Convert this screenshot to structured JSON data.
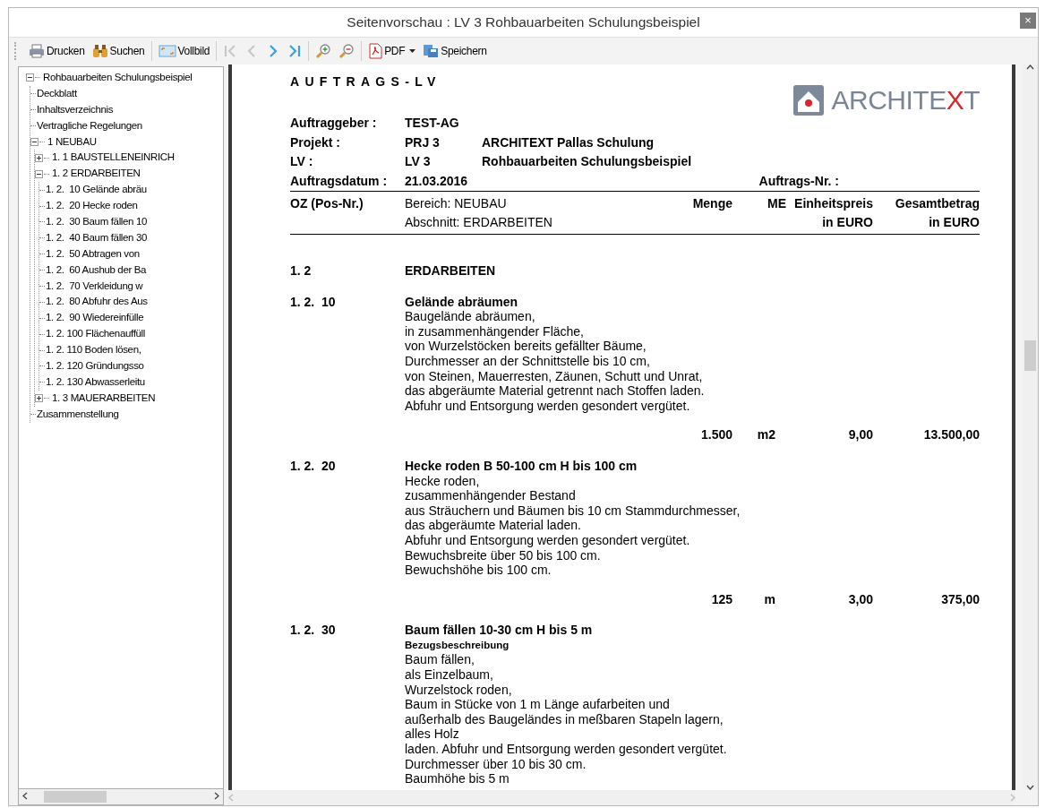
{
  "window": {
    "title": "Seitenvorschau : LV 3 Rohbauarbeiten Schulungsbeispiel",
    "close": "×"
  },
  "toolbar": {
    "groups": [
      {
        "buttons": [
          {
            "kind": "print",
            "label": "Drucken"
          },
          {
            "kind": "search",
            "label": "Suchen"
          }
        ]
      },
      {
        "buttons": [
          {
            "kind": "fullscreen",
            "label": "Vollbild"
          }
        ]
      },
      {
        "buttons": [
          {
            "kind": "first",
            "disabled": true
          },
          {
            "kind": "previous",
            "disabled": true
          },
          {
            "kind": "next",
            "disabled": false
          },
          {
            "kind": "last",
            "disabled": false
          }
        ]
      },
      {
        "buttons": [
          {
            "kind": "zoom-in"
          },
          {
            "kind": "zoom-out"
          }
        ]
      },
      {
        "buttons": [
          {
            "kind": "pdf",
            "label": "PDF",
            "has_menu": true
          },
          {
            "kind": "save",
            "label": "Speichern"
          }
        ]
      }
    ]
  },
  "tree": {
    "items": [
      {
        "label": "Rohbauarbeiten Schulungsbeispiel",
        "expanded": true,
        "children": [
          {
            "label": "Deckblatt"
          },
          {
            "label": "Inhaltsverzeichnis"
          },
          {
            "label": "Vertragliche Regelungen"
          },
          {
            "label": "1 NEUBAU",
            "expanded": true,
            "children": [
              {
                "label": "1. 1 BAUSTELLENEINRICH",
                "expanded": false
              },
              {
                "label": "1. 2 ERDARBEITEN",
                "expanded": true,
                "children": [
                  {
                    "label": "1. 2.  10 Gelände abräu"
                  },
                  {
                    "label": "1. 2.  20 Hecke roden"
                  },
                  {
                    "label": "1. 2.  30 Baum fällen 10"
                  },
                  {
                    "label": "1. 2.  40 Baum fällen 30"
                  },
                  {
                    "label": "1. 2.  50 Abtragen von"
                  },
                  {
                    "label": "1. 2.  60 Aushub der Ba"
                  },
                  {
                    "label": "1. 2.  70 Verkleidung w"
                  },
                  {
                    "label": "1. 2.  80 Abfuhr des Aus"
                  },
                  {
                    "label": "1. 2.  90 Wiedereinfülle"
                  },
                  {
                    "label": "1. 2. 100 Flächenauffüll"
                  },
                  {
                    "label": "1. 2. 110 Boden lösen,"
                  },
                  {
                    "label": "1. 2. 120 Gründungsso"
                  },
                  {
                    "label": "1. 2. 130 Abwasserleitu"
                  }
                ]
              },
              {
                "label": "1. 3 MAUERARBEITEN",
                "expanded": false
              }
            ]
          },
          {
            "label": "Zusammenstellung"
          }
        ]
      }
    ]
  },
  "document": {
    "title": "AUFTRAGS-LV",
    "logo": {
      "parts": [
        {
          "text": "ARCHITE",
          "color": "#7a8595"
        },
        {
          "text": "X",
          "color": "#d8262e"
        },
        {
          "text": "T",
          "color": "#7a8595"
        }
      ]
    },
    "header_fields": [
      {
        "label": "Auftraggeber :",
        "value": "TEST-AG"
      },
      {
        "label": "Projekt :",
        "value": "PRJ 3",
        "detail": "ARCHITEXT Pallas Schulung"
      },
      {
        "label": "LV :",
        "value": "LV 3",
        "detail": "Rohbauarbeiten Schulungsbeispiel"
      },
      {
        "label": "Auftragsdatum :",
        "value": "21.03.2016",
        "right_label": "Auftrags-Nr. :"
      }
    ],
    "columns": {
      "oz": "OZ (Pos-Nr.)",
      "area": "Bereich: NEUBAU",
      "section": "Abschnitt: ERDARBEITEN",
      "quantity": "Menge",
      "unit": "ME",
      "unit_price": [
        "Einheitspreis",
        "in EURO"
      ],
      "total": [
        "Gesamtbetrag",
        "in EURO"
      ]
    },
    "entries": [
      {
        "kind": "group",
        "oz": "1. 2",
        "title": "ERDARBEITEN"
      },
      {
        "kind": "position",
        "oz": "1. 2.  10",
        "title": "Gelände abräumen",
        "lines": [
          "Baugelände abräumen,",
          "in zusammenhängender Fläche,",
          "von Wurzelstöcken bereits gefällter Bäume,",
          "Durchmesser an der Schnittstelle bis 10 cm,",
          "von Steinen, Mauerresten, Zäunen, Schutt und Unrat,",
          "das abgeräumte Material getrennt nach Stoffen laden.",
          "Abfuhr und Entsorgung werden gesondert vergütet."
        ],
        "quantity": "1.500",
        "unit": "m2",
        "unit_price": "9,00",
        "total": "13.500,00"
      },
      {
        "kind": "position",
        "oz": "1. 2.  20",
        "title": "Hecke roden B 50-100 cm H bis 100 cm",
        "lines": [
          "Hecke roden,",
          "zusammenhängender Bestand",
          "aus Sträuchern und Bäumen bis 10 cm Stammdurchmesser,",
          "das abgeräumte Material laden.",
          "Abfuhr und Entsorgung werden gesondert vergütet.",
          "Bewuchsbreite über 50 bis 100 cm.",
          "Bewuchshöhe bis 100 cm."
        ],
        "quantity": "125",
        "unit": "m",
        "unit_price": "3,00",
        "total": "375,00"
      },
      {
        "kind": "position",
        "oz": "1. 2.  30",
        "title": "Baum fällen 10-30 cm H bis 5 m",
        "subtitle": "Bezugsbeschreibung",
        "lines": [
          "Baum fällen,",
          "als Einzelbaum,",
          "Wurzelstock roden,",
          "Baum in Stücke von 1 m Länge aufarbeiten und",
          "außerhalb des Baugeländes in meßbaren Stapeln lagern,",
          "alles Holz",
          "laden. Abfuhr und Entsorgung werden gesondert vergütet.",
          "Durchmesser über 10 bis 30 cm.",
          "Baumhöhe bis 5 m"
        ]
      }
    ]
  }
}
